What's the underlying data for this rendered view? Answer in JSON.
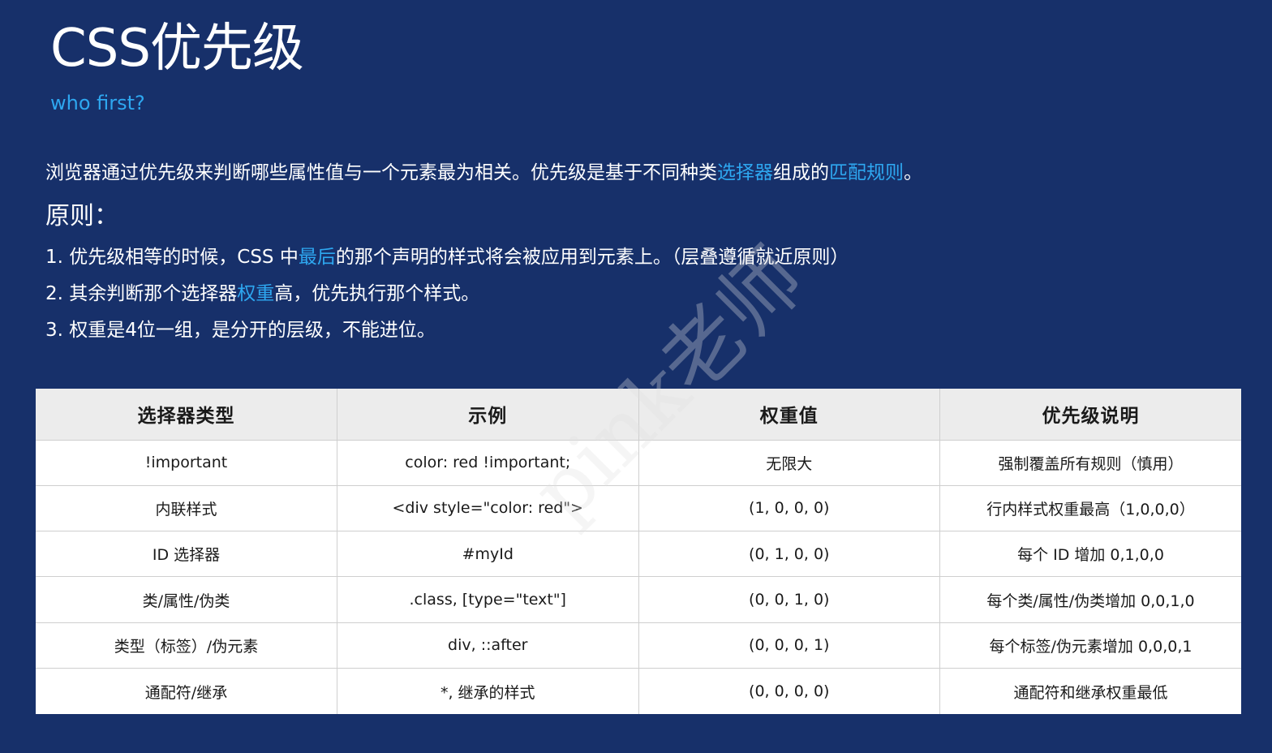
{
  "header": {
    "title": "CSS优先级",
    "subtitle": "who first?"
  },
  "intro": {
    "part1": "浏览器通过优先级来判断哪些属性值与一个元素最为相关。优先级是基于不同种类",
    "highlight1": "选择器",
    "part2": "组成的",
    "highlight2": "匹配规则",
    "part3": "。"
  },
  "principles": {
    "title": "原则：",
    "rule1": {
      "before": "1. 优先级相等的时候，CSS 中",
      "highlight": "最后",
      "after": "的那个声明的样式将会被应用到元素上。（层叠遵循就近原则）"
    },
    "rule2": {
      "before": "2. 其余判断那个选择器",
      "highlight": "权重",
      "after": "高，优先执行那个样式。"
    },
    "rule3": {
      "text": "3. 权重是4位一组，是分开的层级，不能进位。"
    }
  },
  "table": {
    "headers": [
      "选择器类型",
      "示例",
      "权重值",
      "优先级说明"
    ],
    "rows": [
      [
        "!important",
        "color: red !important;",
        "无限大",
        "强制覆盖所有规则（慎用）"
      ],
      [
        "内联样式",
        "<div style=\"color: red\">",
        "(1, 0, 0, 0)",
        "行内样式权重最高（1,0,0,0）"
      ],
      [
        "ID 选择器",
        "#myId",
        "(0, 1, 0, 0)",
        "每个 ID 增加 0,1,0,0"
      ],
      [
        "类/属性/伪类",
        ".class, [type=\"text\"]",
        "(0, 0, 1, 0)",
        "每个类/属性/伪类增加 0,0,1,0"
      ],
      [
        "类型（标签）/伪元素",
        "div, ::after",
        "(0, 0, 0, 1)",
        "每个标签/伪元素增加 0,0,0,1"
      ],
      [
        "通配符/继承",
        "*, 继承的样式",
        "(0, 0, 0, 0)",
        "通配符和继承权重最低"
      ]
    ]
  },
  "watermark": {
    "text": "pink老师"
  },
  "colors": {
    "background": "#17306a",
    "accent": "#2ea7f0",
    "table_header_bg": "#ececec"
  }
}
